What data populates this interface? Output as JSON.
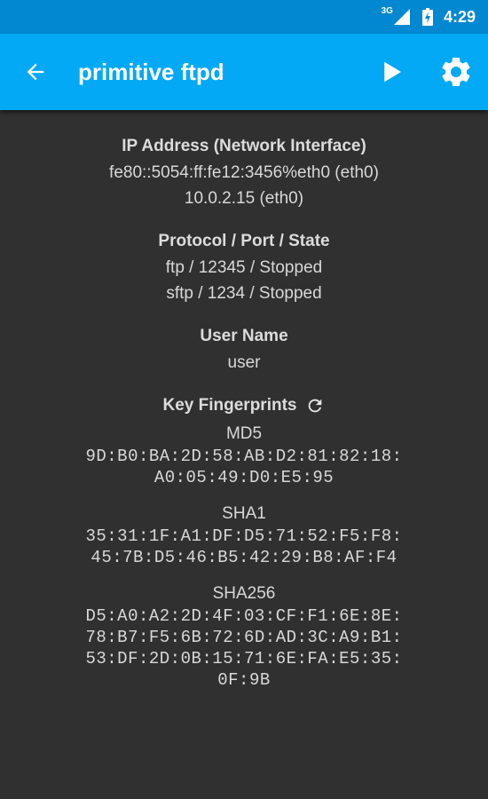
{
  "statusbar": {
    "network": "3G",
    "time": "4:29"
  },
  "appbar": {
    "title": "primitive ftpd"
  },
  "ip": {
    "label": "IP Address (Network Interface)",
    "values": [
      "fe80::5054:ff:fe12:3456%eth0 (eth0)",
      "10.0.2.15 (eth0)"
    ]
  },
  "protocol": {
    "label": "Protocol / Port / State",
    "values": [
      "ftp / 12345 / Stopped",
      "sftp / 1234 / Stopped"
    ]
  },
  "user": {
    "label": "User Name",
    "value": "user"
  },
  "fingerprints": {
    "label": "Key Fingerprints",
    "md5": {
      "name": "MD5",
      "lines": [
        "9D:B0:BA:2D:58:AB:D2:81:82:18:",
        "A0:05:49:D0:E5:95"
      ]
    },
    "sha1": {
      "name": "SHA1",
      "lines": [
        "35:31:1F:A1:DF:D5:71:52:F5:F8:",
        "45:7B:D5:46:B5:42:29:B8:AF:F4"
      ]
    },
    "sha256": {
      "name": "SHA256",
      "lines": [
        "D5:A0:A2:2D:4F:03:CF:F1:6E:8E:",
        "78:B7:F5:6B:72:6D:AD:3C:A9:B1:",
        "53:DF:2D:0B:15:71:6E:FA:E5:35:",
        "0F:9B"
      ]
    }
  },
  "icons": {
    "signal": "cell-signal-icon",
    "battery": "battery-charging-icon",
    "back": "arrow-back-icon",
    "play": "play-icon",
    "settings": "gear-icon",
    "refresh": "refresh-icon"
  },
  "colors": {
    "statusbar": "#0288d1",
    "appbar": "#03a9f4",
    "background": "#303030"
  }
}
